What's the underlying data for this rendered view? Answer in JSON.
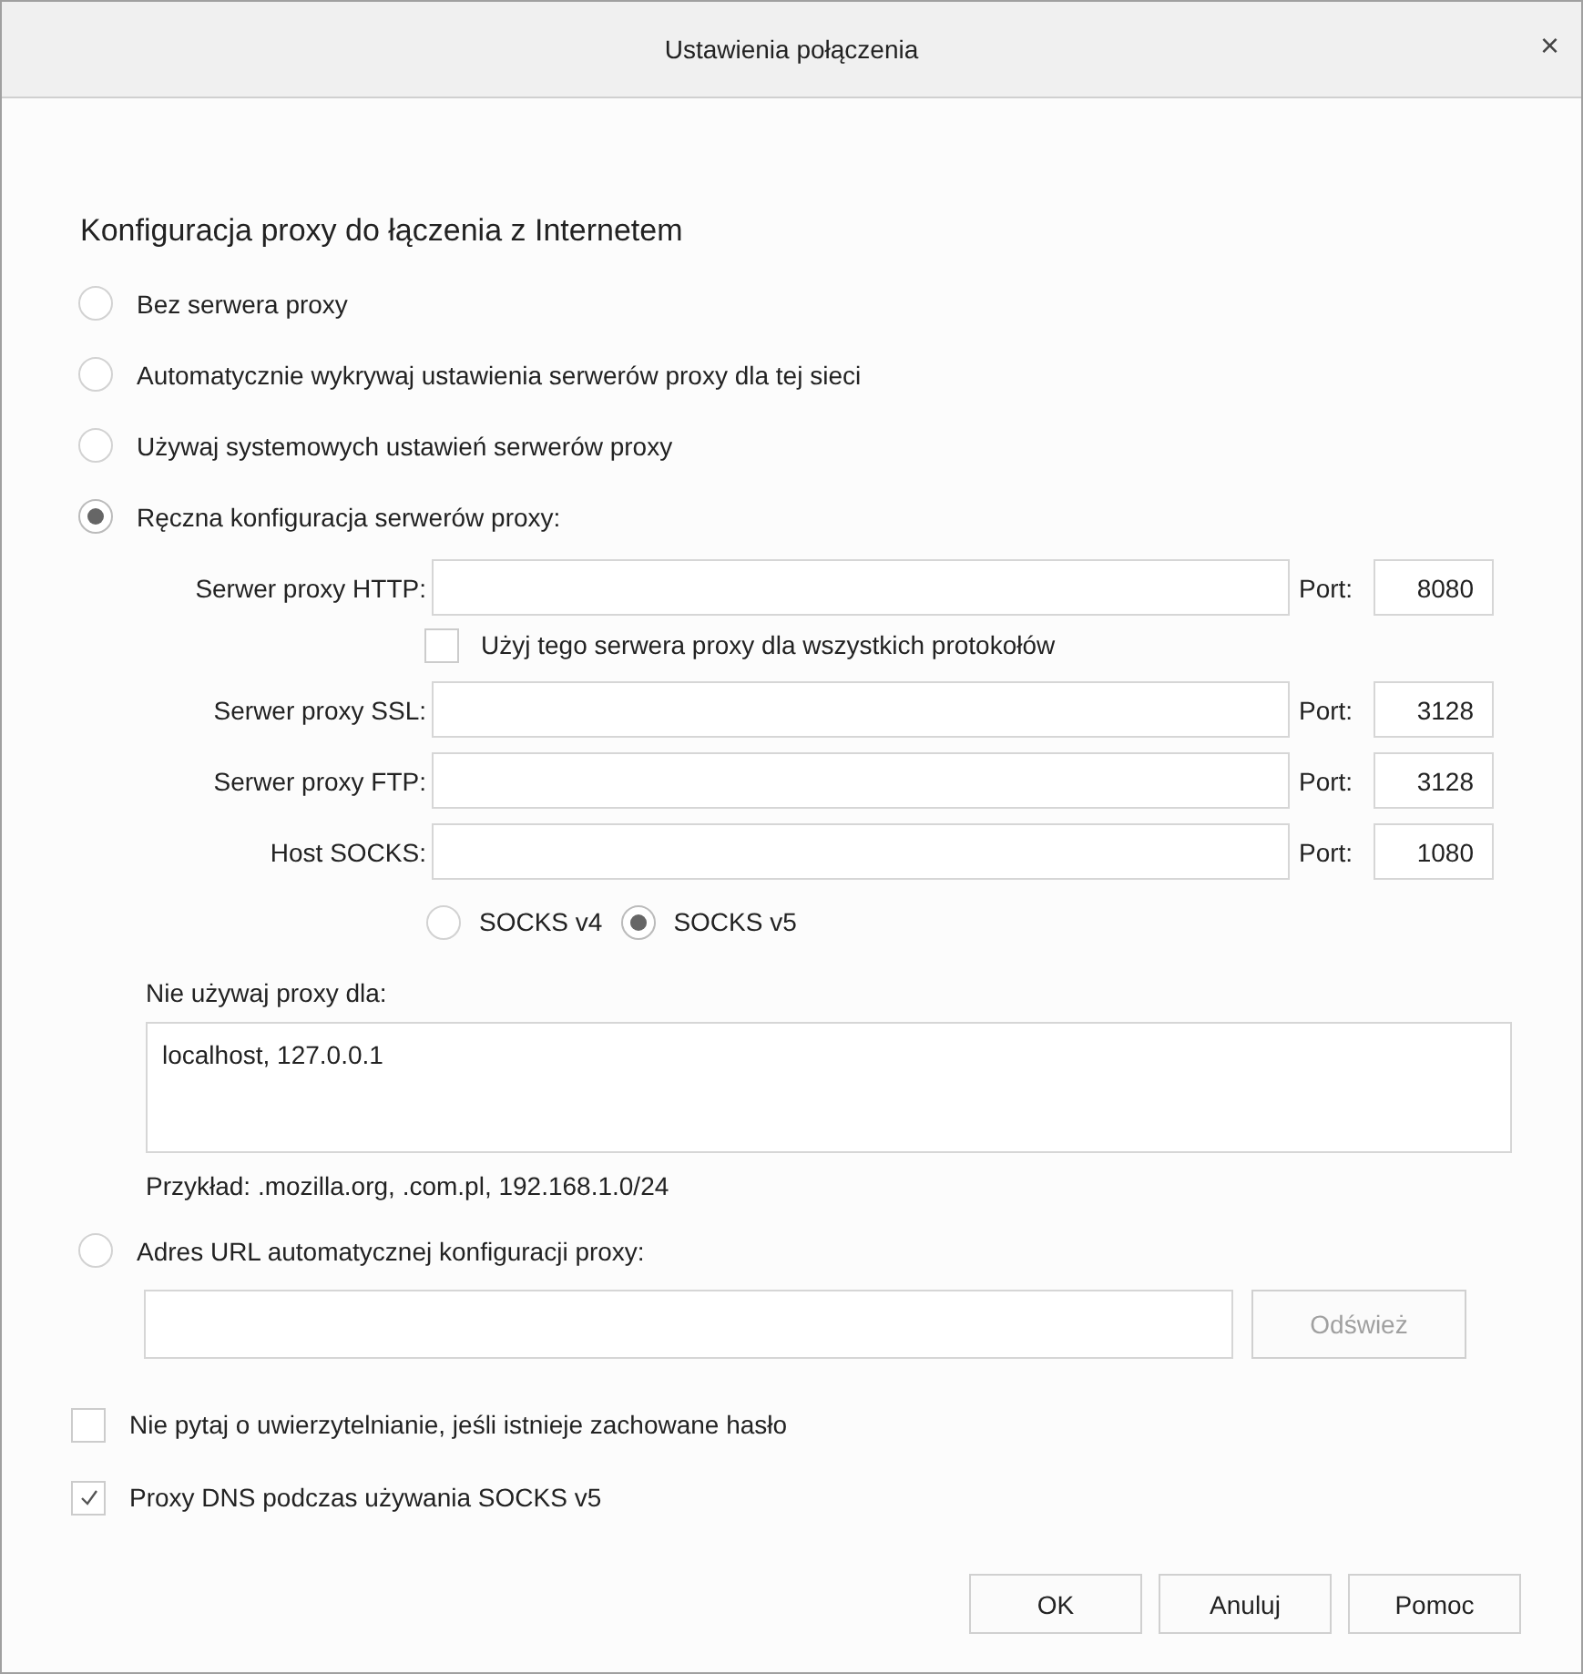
{
  "window": {
    "title": "Ustawienia połączenia",
    "close": "×"
  },
  "heading": "Konfiguracja proxy do łączenia z Internetem",
  "modes": [
    {
      "kind": "simple",
      "label": "Bez serwera proxy",
      "selected": false
    },
    {
      "kind": "simple",
      "label": "Automatycznie wykrywaj ustawienia serwerów proxy dla tej sieci",
      "selected": false
    },
    {
      "kind": "simple",
      "label": "Używaj systemowych ustawień serwerów proxy",
      "selected": false
    },
    {
      "kind": "manual",
      "label": "Ręczna konfiguracja serwerów proxy:",
      "selected": true
    },
    {
      "kind": "auto_url",
      "label": "Adres URL automatycznej konfiguracji proxy:",
      "selected": false
    }
  ],
  "manual": {
    "rows": [
      {
        "kind": "field",
        "label": "Serwer proxy HTTP:",
        "port_label": "Port:",
        "port": "8080"
      },
      {
        "kind": "checkbox",
        "label": "Użyj tego serwera proxy dla wszystkich protokołów",
        "checked": false
      },
      {
        "kind": "field",
        "label": "Serwer proxy SSL:",
        "port_label": "Port:",
        "port": "3128"
      },
      {
        "kind": "field",
        "label": "Serwer proxy FTP:",
        "port_label": "Port:",
        "port": "3128"
      },
      {
        "kind": "field",
        "label": "Host SOCKS:",
        "port_label": "Port:",
        "port": "1080"
      }
    ],
    "socks_versions": [
      {
        "label": "SOCKS v4",
        "selected": false
      },
      {
        "label": "SOCKS v5",
        "selected": true
      }
    ],
    "no_proxy": {
      "label": "Nie używaj proxy dla:",
      "value": "localhost, 127.0.0.1"
    },
    "example": "Przykład: .mozilla.org, .com.pl, 192.168.1.0/24"
  },
  "auto_url": {
    "refresh": "Odśwież",
    "refresh_disabled": true
  },
  "options": [
    {
      "label": "Nie pytaj o uwierzytelnianie, jeśli istnieje zachowane hasło",
      "checked": false
    },
    {
      "label": "Proxy DNS podczas używania SOCKS v5",
      "checked": true
    }
  ],
  "buttons": [
    "OK",
    "Anuluj",
    "Pomoc"
  ]
}
